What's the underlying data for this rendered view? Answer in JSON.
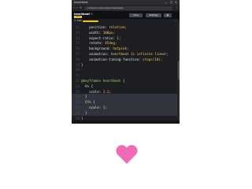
{
  "browser": {
    "tab_title": "heartbeat",
    "window_controls": "— ▢ ✕",
    "url": "codepen.io/alice/pen/heartbeat"
  },
  "pen": {
    "title": "heartbeat",
    "author_badge": "alice",
    "save_label": "Save",
    "settings_label": "Settings",
    "layout_icon": "▦"
  },
  "editor": {
    "language": "CSS",
    "controls": "⌄",
    "lines": [
      {
        "n": "12",
        "text": "    position: relative;"
      },
      {
        "n": "13",
        "text": "    width: 100px;"
      },
      {
        "n": "14",
        "text": "    aspect-ratio: 1;"
      },
      {
        "n": "15",
        "text": "    rotate: 45deg;"
      },
      {
        "n": "16",
        "text": "    background: hotpink;"
      },
      {
        "n": "17",
        "text": "    animation: heartbeat 1s infinite linear;"
      },
      {
        "n": "18",
        "text": "    animation-timing-function: steps(10);"
      },
      {
        "n": "19",
        "text": "}"
      },
      {
        "n": "20",
        "text": ""
      },
      {
        "n": "21",
        "text": ""
      },
      {
        "n": "22",
        "text": "@keyframes heartbeat {"
      },
      {
        "n": "23",
        "text": "  0% {"
      },
      {
        "n": "24",
        "text": "    scale: 1.1;"
      },
      {
        "n": "25",
        "text": "  }"
      },
      {
        "n": "26",
        "text": "  85% {"
      },
      {
        "n": "27",
        "text": "    scale: 1;"
      },
      {
        "n": "28",
        "text": "  }"
      },
      {
        "n": "29",
        "text": "}"
      }
    ]
  },
  "preview": {
    "heart_color": "#f06ab4"
  },
  "colors": {
    "accent_yellow": "#f5c518",
    "editor_bg": "#1d1e22",
    "selector_green": "#a0d66b",
    "value_yellow": "#f6c65b"
  }
}
